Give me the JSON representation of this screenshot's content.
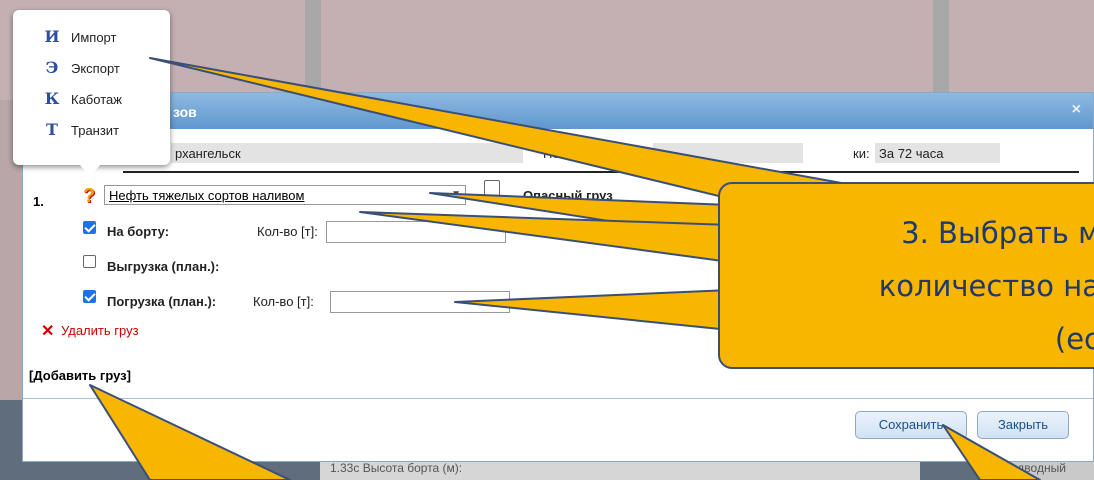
{
  "popup_menu": {
    "items": [
      {
        "label": "Импорт",
        "icon": "import-icon",
        "glyph": "И"
      },
      {
        "label": "Экспорт",
        "icon": "export-icon",
        "glyph": "Э"
      },
      {
        "label": "Каботаж",
        "icon": "cabotage-icon",
        "glyph": "К"
      },
      {
        "label": "Транзит",
        "icon": "transit-icon",
        "glyph": "Т"
      }
    ]
  },
  "dialog": {
    "title_fragment": "зов",
    "close_glyph": "×",
    "port_value": "рхангельск",
    "request_number_label": "Номер заявки:",
    "request_number_value": "",
    "timing_label_fragment": "ки:",
    "timing_value": "За 72 часа"
  },
  "cargo": {
    "index": "1.",
    "type_value": "Нефть тяжелых сортов наливом",
    "dangerous_label": "Опасный груз",
    "dangerous_checked": false,
    "on_board": {
      "label": "На борту:",
      "checked": true,
      "qty_label": "Кол-во [т]:",
      "qty_value": ""
    },
    "unloading": {
      "label": "Выгрузка (план.):",
      "checked": false
    },
    "loading": {
      "label": "Погрузка (план.):",
      "checked": true,
      "qty_label": "Кол-во [т]:",
      "qty_value": ""
    },
    "delete_label": "Удалить груз",
    "delete_glyph": "✕"
  },
  "add_cargo_label": "[Добавить груз]",
  "buttons": {
    "save": "Сохранить",
    "close": "Закрыть"
  },
  "background_text": {
    "under_left": "1.33с Высота борта (м):",
    "under_right": "надводный"
  },
  "callout": {
    "lines": [
      "3. Выбрать м",
      "количество на",
      "(ес"
    ]
  },
  "colors": {
    "callout_fill": "#f8b600",
    "callout_border": "#3a4f78",
    "titlebar": "#6fa3d6",
    "delete_red": "#cc0000",
    "checkbox_blue": "#1a73e8"
  }
}
